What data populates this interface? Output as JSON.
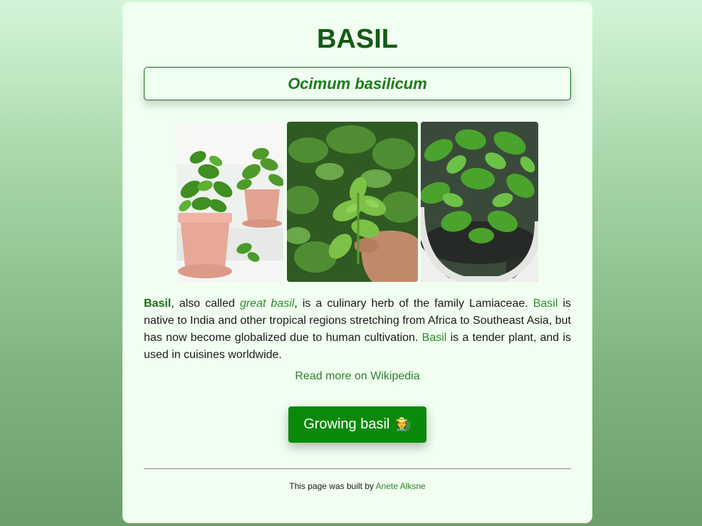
{
  "page": {
    "title": "BASIL",
    "scientific_name": "Ocimum basilicum"
  },
  "gallery": {
    "images": [
      {
        "description": "potted basil on windowsill"
      },
      {
        "description": "hand holding basil sprig"
      },
      {
        "description": "basil in white pot"
      }
    ]
  },
  "description": {
    "part1_bold": "Basil",
    "part2": ", also called ",
    "part3_italic": "great basil",
    "part4": ", is a culinary herb of the family Lamiaceae. ",
    "part5_green": "Basil",
    "part6": " is native to India and other tropical regions stretching from Africa to Southeast Asia, but has now become globalized due to human cultivation. ",
    "part7_green": "Basil",
    "part8": " is a tender plant, and is used in cuisines worldwide."
  },
  "links": {
    "wikipedia": "Read more on Wikipedia"
  },
  "button": {
    "label": "Growing basil",
    "emoji": "🧑‍🌾"
  },
  "footer": {
    "prefix": "This page was built by ",
    "author": "Anete Alksne"
  },
  "colors": {
    "title": "#145a14",
    "accent": "#2e8b2e",
    "button_bg": "#0a8a0a",
    "card_bg": "#f0fff0"
  }
}
